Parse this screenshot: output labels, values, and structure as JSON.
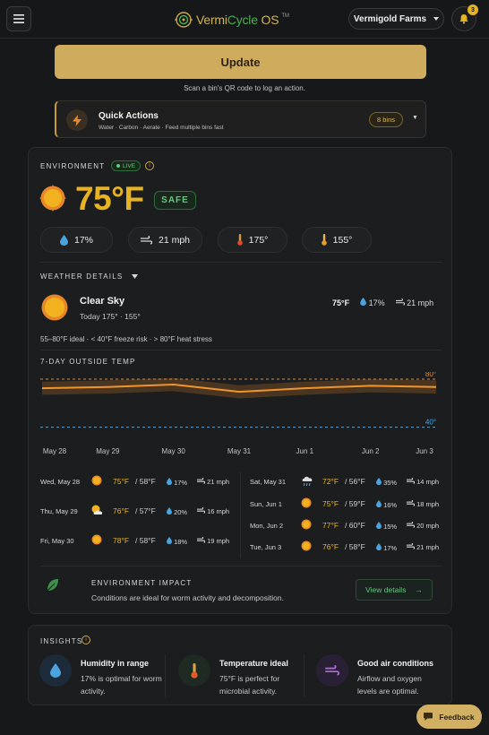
{
  "header": {
    "logo_main": "Vermi",
    "logo_green": "Cycle",
    "logo_os": "OS",
    "logo_tm": "TM",
    "farm_name": "Vermigold Farms",
    "notification_count": "3"
  },
  "update": {
    "button_label": "Update",
    "hint": "Scan a bin's QR code to log an action."
  },
  "quick_actions": {
    "title": "Quick Actions",
    "subtitle": "Water · Carbon · Aerate · Feed multiple bins fast",
    "badge": "8 bins"
  },
  "environment": {
    "label": "ENVIRONMENT",
    "live_badge": "LIVE",
    "temperature": "75°F",
    "status": "SAFE",
    "pills": {
      "humidity": "17%",
      "wind": "21 mph",
      "temp_a": "175°",
      "temp_b": "155°"
    },
    "weather_details_label": "WEATHER DETAILS",
    "current": {
      "condition": "Clear Sky",
      "today": "Today 175° · 155°",
      "temp": "75°F",
      "humidity": "17%",
      "wind": "21 mph"
    },
    "ideal_range": "55–80°F ideal · < 40°F freeze risk · > 80°F heat stress",
    "seven_day_label": "7-DAY OUTSIDE TEMP"
  },
  "chart_data": {
    "type": "area",
    "x": [
      "May 28",
      "May 29",
      "May 30",
      "May 31",
      "Jun 1",
      "Jun 2",
      "Jun 3"
    ],
    "series": [
      {
        "values": [
          75,
          76,
          78,
          72,
          75,
          77,
          76
        ]
      },
      {
        "values": [
          58,
          57,
          58,
          56,
          59,
          60,
          58
        ]
      }
    ],
    "thresholds": [
      80,
      40
    ],
    "threshold_labels": [
      "80°",
      "40°"
    ],
    "threshold_colors": [
      "#e8862a",
      "#4aa3df"
    ],
    "series_color": "#f0952e",
    "ylim": [
      30,
      86
    ]
  },
  "forecast": [
    {
      "day": "Wed, May 28",
      "icon": "sun-icon",
      "hi": "75°F",
      "lo": "58°F",
      "humidity": "17%",
      "wind": "21 mph"
    },
    {
      "day": "Thu, May 29",
      "icon": "partly-cloudy-icon",
      "hi": "76°F",
      "lo": "57°F",
      "humidity": "20%",
      "wind": "16 mph"
    },
    {
      "day": "Fri, May 30",
      "icon": "sun-icon",
      "hi": "78°F",
      "lo": "58°F",
      "humidity": "18%",
      "wind": "19 mph"
    },
    {
      "day": "Sat, May 31",
      "icon": "rain-icon",
      "hi": "72°F",
      "lo": "56°F",
      "humidity": "35%",
      "wind": "14 mph"
    },
    {
      "day": "Sun, Jun 1",
      "icon": "sun-icon",
      "hi": "75°F",
      "lo": "59°F",
      "humidity": "16%",
      "wind": "18 mph"
    },
    {
      "day": "Mon, Jun 2",
      "icon": "sun-icon",
      "hi": "77°F",
      "lo": "60°F",
      "humidity": "15%",
      "wind": "20 mph"
    },
    {
      "day": "Tue, Jun 3",
      "icon": "sun-icon",
      "hi": "76°F",
      "lo": "58°F",
      "humidity": "17%",
      "wind": "21 mph"
    }
  ],
  "impact": {
    "label": "ENVIRONMENT IMPACT",
    "text": "Conditions are ideal for worm activity and decomposition.",
    "button": "View details",
    "arrow": "→"
  },
  "insights": {
    "label": "INSIGHTS",
    "items": [
      {
        "title": "Humidity in range",
        "text": "17% is optimal for worm activity.",
        "icon": "droplet-icon"
      },
      {
        "title": "Temperature ideal",
        "text": "75°F is perfect for microbial activity.",
        "icon": "thermometer-icon"
      },
      {
        "title": "Good air conditions",
        "text": "Airflow and oxygen levels are optimal.",
        "icon": "wind-icon"
      }
    ]
  },
  "feedback": {
    "label": "Feedback"
  },
  "colors": {
    "accent": "#e6b422",
    "button_gold": "#cfab5d",
    "safe_green": "#63c77a",
    "background": "#17181a"
  }
}
